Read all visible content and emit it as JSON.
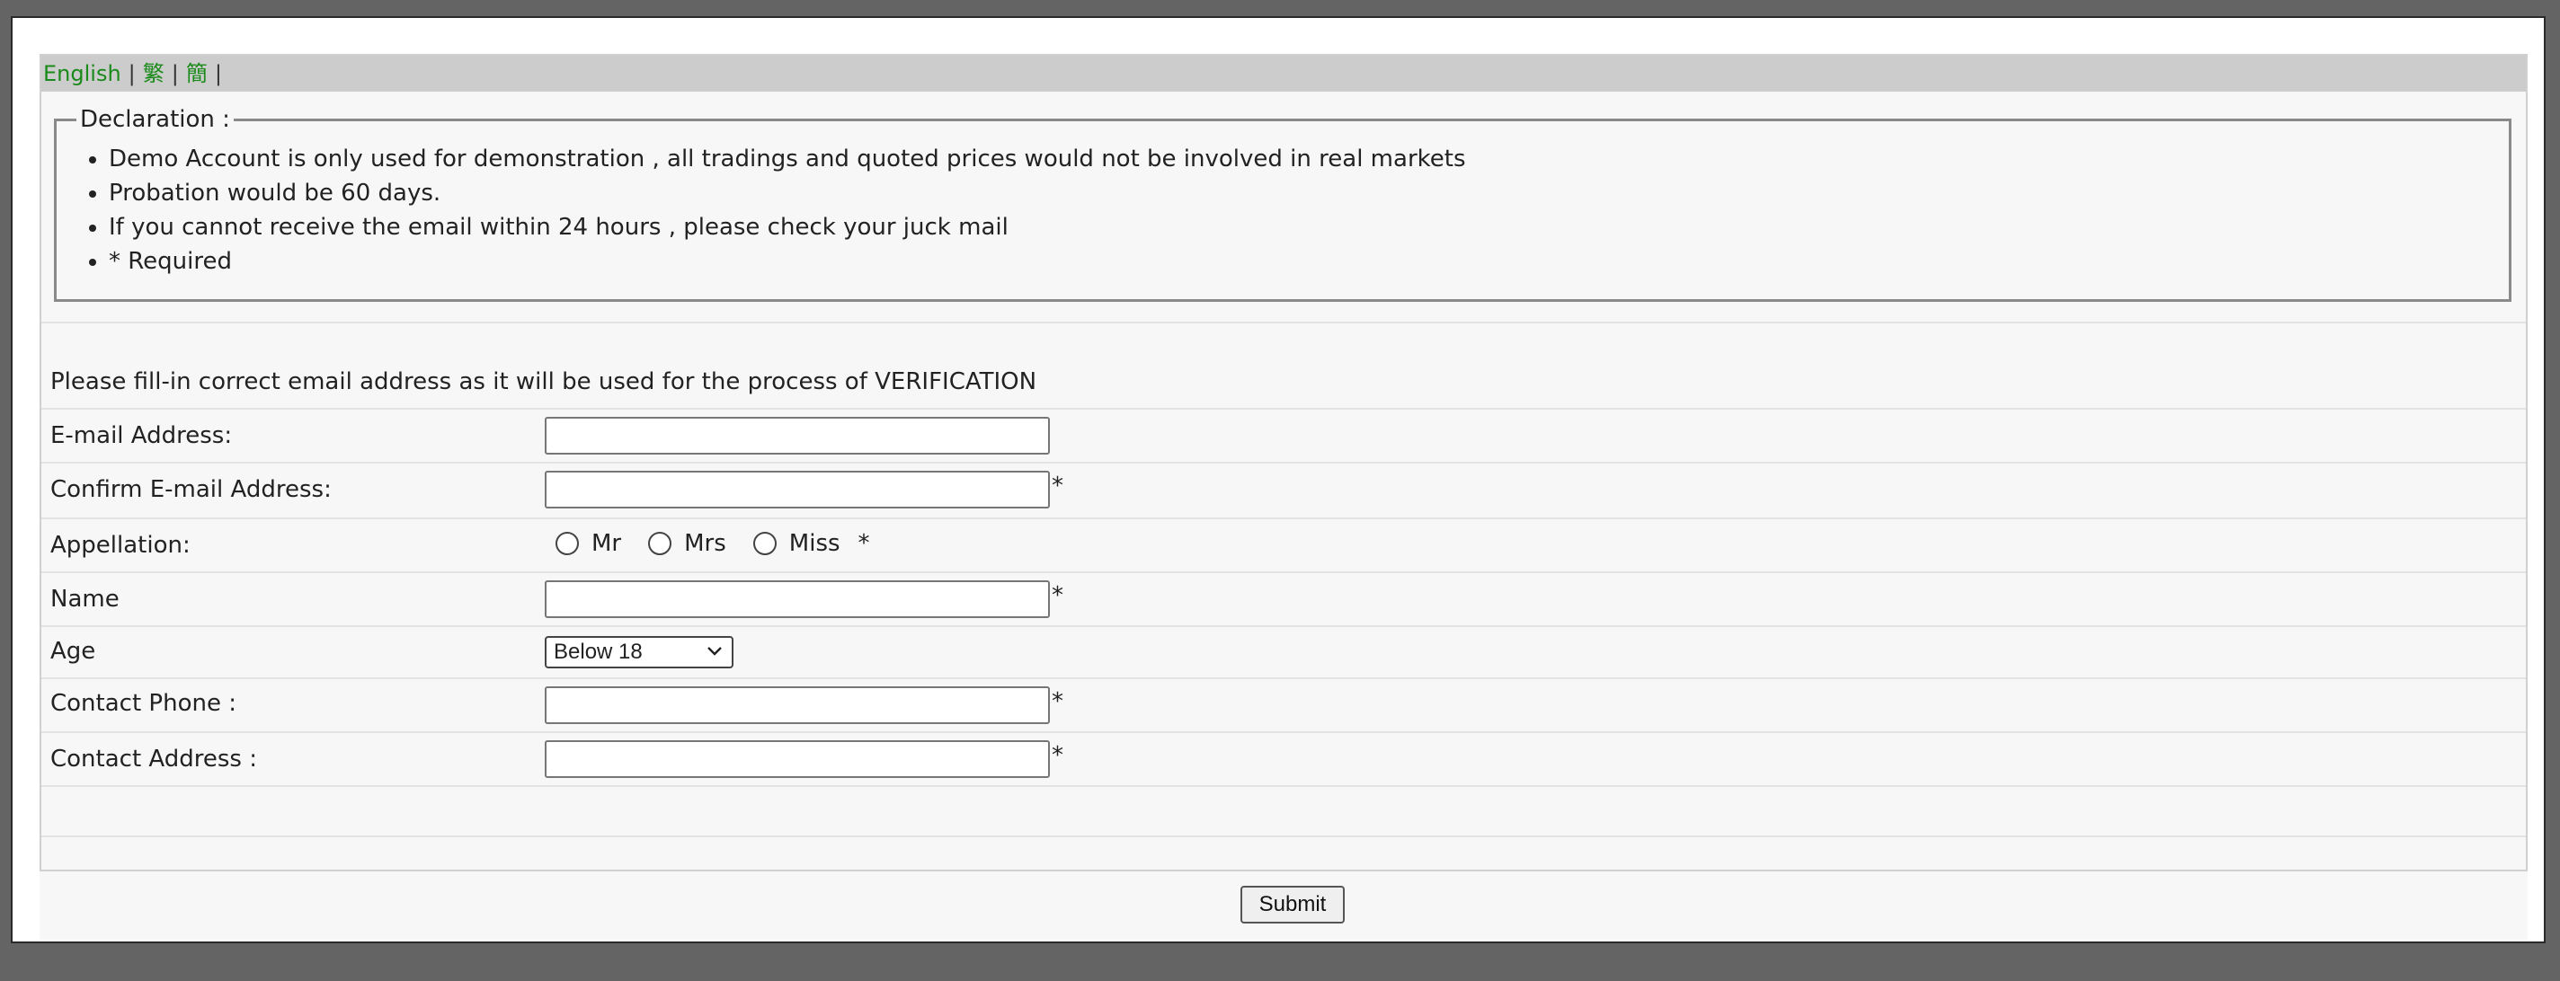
{
  "language_bar": {
    "english": "English",
    "traditional": "繁",
    "simplified": "簡",
    "separator": "|"
  },
  "declaration": {
    "legend": "Declaration :",
    "items": [
      "Demo Account is only used for demonstration , all tradings and quoted prices would not be involved in real markets",
      "Probation would be 60 days.",
      "If you cannot receive the email within 24 hours , please check your juck mail",
      "* Required"
    ]
  },
  "form": {
    "notice": "Please fill-in correct email address as it will be used for the process of VERIFICATION",
    "required_mark": "*",
    "email_label": "E-mail Address:",
    "email_value": "",
    "confirm_email_label": "Confirm E-mail Address:",
    "confirm_email_value": "",
    "appellation_label": "Appellation:",
    "appellation_options": [
      "Mr",
      "Mrs",
      "Miss"
    ],
    "name_label": "Name",
    "name_value": "",
    "age_label": "Age",
    "age_selected": "Below 18",
    "phone_label": "Contact Phone :",
    "phone_value": "",
    "address_label": "Contact Address :",
    "address_value": ""
  },
  "actions": {
    "submit_label": "Submit"
  },
  "icons": {
    "select_arrow": "chevron-down-icon"
  }
}
